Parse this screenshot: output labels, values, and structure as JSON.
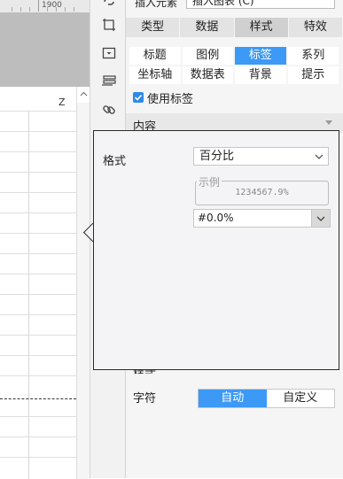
{
  "ruler": {
    "label": "1900"
  },
  "sheet": {
    "column_label": "Z"
  },
  "icons": [
    "link-icon",
    "crop-icon",
    "dropdown-box-icon",
    "layers-icon",
    "chain-link-icon"
  ],
  "insert": {
    "label": "插入元素",
    "dropdown_value": "插入图表 (C)"
  },
  "tabs": [
    {
      "label": "类型"
    },
    {
      "label": "数据"
    },
    {
      "label": "样式"
    },
    {
      "label": "特效"
    }
  ],
  "subtabs": [
    {
      "label": "标题"
    },
    {
      "label": "图例"
    },
    {
      "label": "标签"
    },
    {
      "label": "系列"
    },
    {
      "label": "坐标轴"
    },
    {
      "label": "数据表"
    },
    {
      "label": "背景"
    },
    {
      "label": "提示"
    }
  ],
  "use_label": {
    "text": "使用标签",
    "checked": true
  },
  "content_section": {
    "title": "内容"
  },
  "popup": {
    "format_label": "格式",
    "format_value": "百分比",
    "example_legend": "示例",
    "example_value": "1234567.9%",
    "pattern_value": "#0.0%"
  },
  "obscured_label": "样式",
  "char_row": {
    "label": "字符",
    "options": [
      "自动",
      "自定义"
    ],
    "selected": "自动"
  },
  "colors": {
    "accent": "#3c99f5",
    "checkbox": "#2f8ae8",
    "popup_border": "#2a2a2a"
  }
}
